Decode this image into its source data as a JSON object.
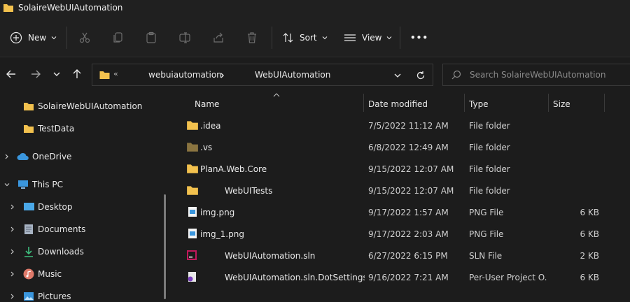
{
  "window": {
    "title": "SolaireWebUIAutomation"
  },
  "toolbar": {
    "new_label": "New",
    "sort_label": "Sort",
    "view_label": "View",
    "more_label": "•••"
  },
  "address": {
    "overflow": "«",
    "crumbs": [
      "webuiautomation",
      "WebUIAutomation"
    ]
  },
  "search": {
    "placeholder": "Search SolaireWebUIAutomation"
  },
  "sidebar": {
    "items": [
      {
        "label": "SolaireWebUIAutomation",
        "icon": "folder-icon"
      },
      {
        "label": "TestData",
        "icon": "folder-icon"
      },
      {
        "label": "OneDrive",
        "icon": "cloud-icon"
      },
      {
        "label": "This PC",
        "icon": "computer-icon"
      },
      {
        "label": "Desktop",
        "icon": "desktop-icon"
      },
      {
        "label": "Documents",
        "icon": "document-icon"
      },
      {
        "label": "Downloads",
        "icon": "download-icon"
      },
      {
        "label": "Music",
        "icon": "music-icon"
      },
      {
        "label": "Pictures",
        "icon": "pictures-icon"
      }
    ]
  },
  "columns": {
    "name": "Name",
    "date": "Date modified",
    "type": "Type",
    "size": "Size"
  },
  "files": [
    {
      "name": ".idea",
      "date": "7/5/2022 11:12 AM",
      "type": "File folder",
      "size": "",
      "icon": "folder-icon"
    },
    {
      "name": ".vs",
      "date": "6/8/2022 12:49 AM",
      "type": "File folder",
      "size": "",
      "icon": "hidden-folder-icon"
    },
    {
      "name": "PlanA.Web.Core",
      "date": "9/15/2022 12:07 AM",
      "type": "File folder",
      "size": "",
      "icon": "folder-icon"
    },
    {
      "name": "WebUITests",
      "date": "9/15/2022 12:07 AM",
      "type": "File folder",
      "size": "",
      "icon": "folder-icon"
    },
    {
      "name": "img.png",
      "date": "9/17/2022 1:57 AM",
      "type": "PNG File",
      "size": "6 KB",
      "icon": "image-file-icon"
    },
    {
      "name": "img_1.png",
      "date": "9/17/2022 2:03 AM",
      "type": "PNG File",
      "size": "6 KB",
      "icon": "image-file-icon"
    },
    {
      "name": "WebUIAutomation.sln",
      "date": "6/27/2022 6:15 PM",
      "type": "SLN File",
      "size": "2 KB",
      "icon": "rider-sln-icon"
    },
    {
      "name": "WebUIAutomation.sln.DotSettings...",
      "date": "9/16/2022 7:21 AM",
      "type": "Per-User Project O...",
      "size": "6 KB",
      "icon": "dotsettings-icon"
    }
  ],
  "colors": {
    "folder": "#f2c14e",
    "folder_dim": "#8a7440",
    "accent": "#3a96dd"
  }
}
